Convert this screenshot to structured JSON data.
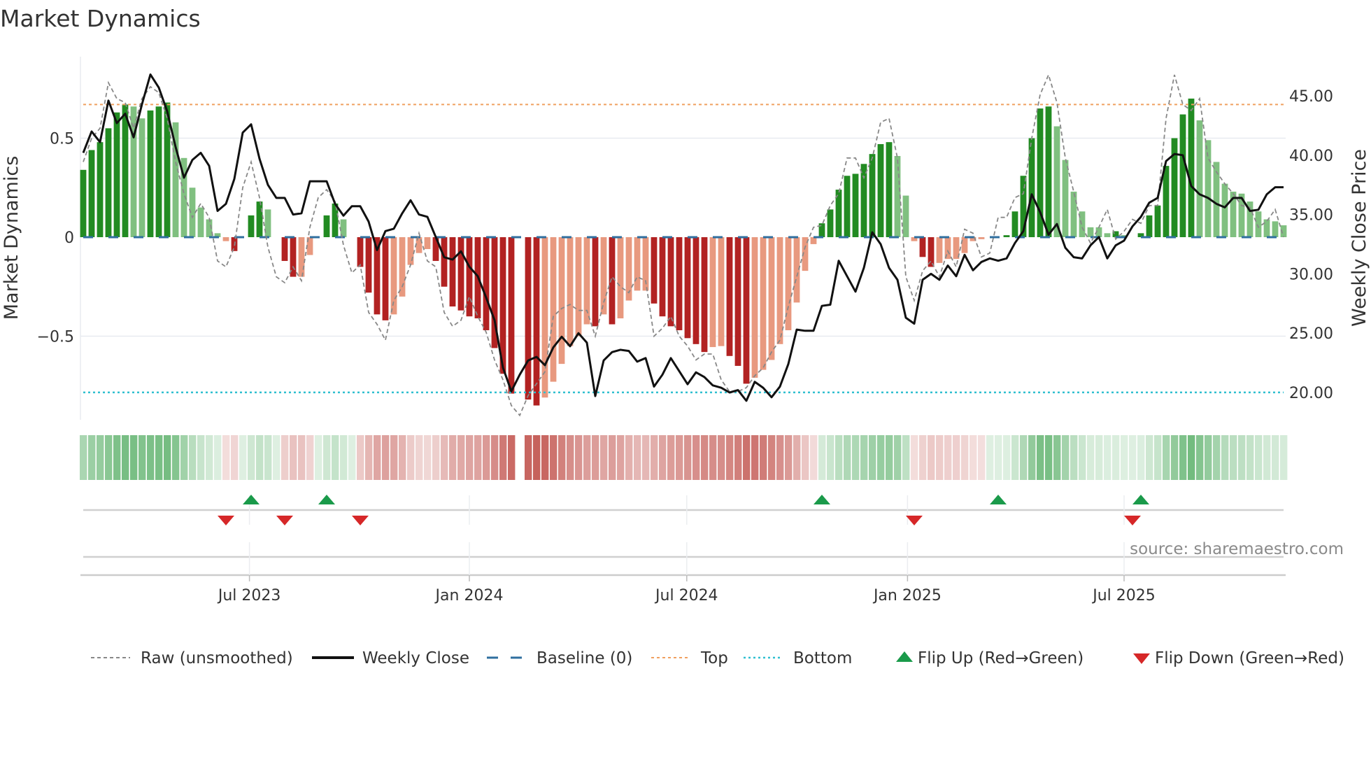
{
  "title": "Market Dynamics",
  "source": "source: sharemaestro.com",
  "colors": {
    "green_dark": "#228b22",
    "green_light": "#80c080",
    "red_dark": "#b22222",
    "red_light": "#e8997f",
    "close": "#111111",
    "raw": "#888888",
    "baseline": "#2f6f9f",
    "top": "#f0a060",
    "bottom": "#30c0d0",
    "flip_up": "#1a9a4a",
    "flip_down": "#d62728"
  },
  "chart_data": {
    "type": "bar",
    "title": "Market Dynamics",
    "ylabel": "Market Dynamics",
    "y2label": "Weekly Close Price",
    "ylim": [
      -0.92,
      0.91
    ],
    "y2lim": [
      17.8,
      48.5
    ],
    "yticks": [
      {
        "v": 0.5,
        "label": "0.5"
      },
      {
        "v": 0,
        "label": "0"
      },
      {
        "v": -0.5,
        "label": "−0.5"
      }
    ],
    "y2ticks": [
      {
        "v": 45,
        "label": "45.00"
      },
      {
        "v": 40,
        "label": "40.00"
      },
      {
        "v": 35,
        "label": "35.00"
      },
      {
        "v": 30,
        "label": "30.00"
      },
      {
        "v": 25,
        "label": "25.00"
      },
      {
        "v": 20,
        "label": "20.00"
      }
    ],
    "xticks": [
      {
        "week": 19.8,
        "label": "Jul 2023"
      },
      {
        "week": 46.0,
        "label": "Jan 2024"
      },
      {
        "week": 71.9,
        "label": "Jul 2024"
      },
      {
        "week": 98.2,
        "label": "Jan 2025"
      },
      {
        "week": 124.0,
        "label": "Jul 2025"
      }
    ],
    "top_level": 0.67,
    "bottom_level": -0.784,
    "baseline": 0,
    "dynamics": [
      0.34,
      0.44,
      0.48,
      0.55,
      0.63,
      0.67,
      0.66,
      0.6,
      0.64,
      0.66,
      0.68,
      0.58,
      0.4,
      0.25,
      0.15,
      0.09,
      0.02,
      -0.02,
      -0.07,
      0.0,
      0.11,
      0.18,
      0.14,
      0.0,
      -0.12,
      -0.2,
      -0.2,
      -0.09,
      0.0,
      0.11,
      0.17,
      0.09,
      0.0,
      -0.15,
      -0.28,
      -0.39,
      -0.42,
      -0.39,
      -0.3,
      -0.14,
      -0.08,
      -0.06,
      -0.12,
      -0.25,
      -0.35,
      -0.37,
      -0.4,
      -0.41,
      -0.47,
      -0.56,
      -0.69,
      -0.79,
      null,
      -0.82,
      -0.85,
      -0.81,
      -0.73,
      -0.64,
      -0.55,
      -0.5,
      -0.44,
      -0.45,
      -0.39,
      -0.44,
      -0.41,
      -0.32,
      -0.27,
      -0.27,
      -0.335,
      -0.4,
      -0.45,
      -0.47,
      -0.51,
      -0.54,
      -0.58,
      -0.555,
      -0.55,
      -0.6,
      -0.65,
      -0.74,
      -0.71,
      -0.67,
      -0.62,
      -0.54,
      -0.47,
      -0.33,
      -0.17,
      -0.035,
      0.07,
      0.14,
      0.24,
      0.31,
      0.32,
      0.37,
      0.42,
      0.47,
      0.48,
      0.41,
      0.21,
      -0.02,
      -0.1,
      -0.15,
      -0.13,
      -0.11,
      -0.11,
      -0.08,
      -0.02,
      -0.01,
      0.0,
      0.0,
      0.01,
      0.13,
      0.31,
      0.5,
      0.65,
      0.66,
      0.56,
      0.39,
      0.23,
      0.13,
      0.05,
      0.05,
      0.02,
      0.03,
      0.01,
      0.0,
      0.02,
      0.11,
      0.16,
      0.36,
      0.5,
      0.62,
      0.7,
      0.59,
      0.49,
      0.38,
      0.27,
      0.23,
      0.22,
      0.18,
      0.13,
      0.09,
      0.08,
      0.06
    ],
    "raw": [
      0.38,
      0.5,
      0.55,
      0.78,
      0.7,
      0.68,
      0.55,
      0.7,
      0.76,
      0.73,
      0.6,
      0.38,
      0.22,
      0.1,
      0.17,
      0.1,
      -0.12,
      -0.15,
      -0.05,
      0.25,
      0.38,
      0.2,
      -0.05,
      -0.2,
      -0.23,
      -0.15,
      -0.22,
      0.05,
      0.2,
      0.24,
      0.18,
      -0.04,
      -0.18,
      -0.14,
      -0.38,
      -0.44,
      -0.52,
      -0.32,
      -0.25,
      -0.14,
      0.02,
      -0.12,
      -0.15,
      -0.38,
      -0.45,
      -0.42,
      -0.3,
      -0.4,
      -0.48,
      -0.62,
      -0.72,
      -0.85,
      -0.9,
      -0.8,
      -0.74,
      -0.68,
      -0.4,
      -0.36,
      -0.34,
      -0.37,
      -0.37,
      -0.5,
      -0.33,
      -0.2,
      -0.25,
      -0.28,
      -0.2,
      -0.22,
      -0.5,
      -0.46,
      -0.4,
      -0.5,
      -0.55,
      -0.62,
      -0.59,
      -0.59,
      -0.72,
      -0.78,
      -0.78,
      -0.76,
      -0.7,
      -0.66,
      -0.58,
      -0.52,
      -0.35,
      -0.2,
      -0.05,
      0.05,
      0.06,
      0.16,
      0.22,
      0.4,
      0.4,
      0.3,
      0.4,
      0.58,
      0.6,
      0.4,
      -0.2,
      -0.32,
      -0.17,
      -0.12,
      -0.2,
      -0.07,
      -0.15,
      0.04,
      0.02,
      -0.1,
      -0.08,
      0.1,
      0.1,
      0.2,
      0.22,
      0.5,
      0.72,
      0.82,
      0.68,
      0.4,
      0.23,
      0.05,
      -0.03,
      0.05,
      0.14,
      -0.01,
      0.03,
      0.09,
      0.07,
      0.16,
      0.16,
      0.6,
      0.82,
      0.67,
      0.64,
      0.7,
      0.4,
      0.33,
      0.27,
      0.22,
      0.16,
      0.15,
      0.05,
      0.08,
      0.14,
      0.0
    ],
    "close": [
      40.2,
      42.0,
      41.1,
      44.6,
      42.7,
      43.5,
      41.5,
      44.3,
      46.8,
      45.7,
      43.7,
      40.7,
      38.1,
      39.6,
      40.2,
      39.1,
      35.3,
      35.9,
      38.0,
      41.9,
      42.6,
      39.7,
      37.5,
      36.4,
      36.4,
      35.0,
      35.1,
      37.8,
      37.8,
      37.8,
      35.9,
      34.9,
      35.7,
      35.7,
      34.4,
      32.0,
      33.6,
      33.8,
      35.1,
      36.2,
      35.0,
      34.8,
      33.1,
      31.4,
      31.2,
      31.9,
      30.6,
      29.8,
      28.0,
      26.1,
      22.1,
      20.1,
      21.5,
      22.7,
      23.0,
      22.3,
      23.8,
      24.7,
      23.9,
      25.0,
      24.2,
      19.7,
      22.7,
      23.4,
      23.6,
      23.5,
      22.6,
      22.9,
      20.5,
      21.5,
      22.9,
      21.8,
      20.7,
      21.7,
      21.3,
      20.6,
      20.4,
      20.0,
      20.2,
      19.3,
      20.9,
      20.4,
      19.6,
      20.5,
      22.4,
      25.3,
      25.2,
      25.2,
      27.3,
      27.4,
      31.1,
      29.8,
      28.5,
      30.5,
      33.5,
      32.5,
      30.5,
      29.5,
      26.3,
      25.8,
      29.5,
      30.0,
      29.5,
      30.7,
      29.8,
      31.6,
      30.3,
      31.0,
      31.3,
      31.1,
      31.3,
      32.6,
      33.6,
      36.7,
      35.2,
      33.3,
      34.2,
      32.2,
      31.4,
      31.3,
      32.4,
      33.1,
      31.3,
      32.4,
      32.8,
      34.0,
      34.8,
      36.0,
      36.4,
      39.5,
      40.1,
      40.0,
      37.4,
      36.7,
      36.4,
      35.9,
      35.6,
      36.4,
      36.4,
      35.3,
      35.4,
      36.7,
      37.3,
      37.3
    ],
    "flip_up_weeks": [
      20,
      29,
      88,
      109,
      126
    ],
    "flip_down_weeks": [
      17,
      24,
      33,
      99,
      125
    ],
    "legend": [
      {
        "key": "raw",
        "label": "Raw (unsmoothed)"
      },
      {
        "key": "close",
        "label": "Weekly Close"
      },
      {
        "key": "baseline",
        "label": "Baseline (0)"
      },
      {
        "key": "top",
        "label": "Top"
      },
      {
        "key": "bottom",
        "label": "Bottom"
      },
      {
        "key": "flip_up",
        "label": "Flip Up (Red→Green)"
      },
      {
        "key": "flip_down",
        "label": "Flip Down (Green→Red)"
      }
    ],
    "legend_position": "bottom"
  }
}
